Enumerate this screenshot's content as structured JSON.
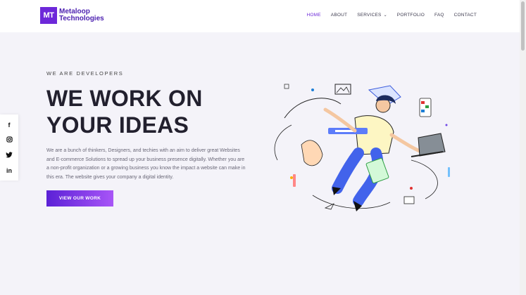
{
  "header": {
    "logo_mark": "MT",
    "logo_line1": "Metaloop",
    "logo_line2": "Technologies",
    "nav": [
      {
        "label": "HOME",
        "active": true
      },
      {
        "label": "ABOUT"
      },
      {
        "label": "SERVICES"
      },
      {
        "label": "PORTFOLIO"
      },
      {
        "label": "FAQ"
      },
      {
        "label": "CONTACT"
      }
    ]
  },
  "social": [
    "f",
    "ig",
    "tw",
    "in"
  ],
  "hero": {
    "eyebrow": "WE ARE DEVELOPERS",
    "headline_line1": "WE WORK ON",
    "headline_line2": "YOUR IDEAS",
    "description": "We are a bunch of thinkers, Designers, and techies with an aim to deliver great Websites and E-commerce Solutions to spread up your business presence digitally. Whether you are a non-profit organization or a growing business you know the impact a website can make in this era. The website gives your company a digital identity.",
    "cta_label": "VIEW OUR WORK"
  },
  "colors": {
    "brand": "#6d28d9",
    "headline": "#22202e",
    "background": "#f4f3f9"
  }
}
